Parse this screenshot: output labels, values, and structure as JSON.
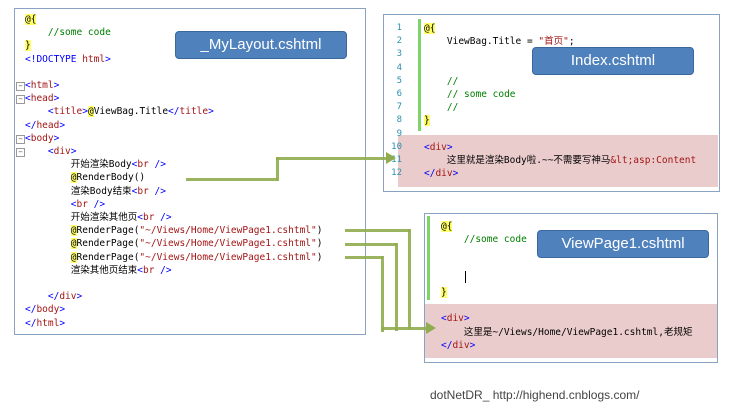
{
  "layout_panel": {
    "badge": "_MyLayout.cshtml",
    "lines": [
      {
        "parts": [
          {
            "t": "@{",
            "c": "razor"
          }
        ]
      },
      {
        "parts": [
          {
            "t": "    //some code",
            "c": "green"
          }
        ]
      },
      {
        "parts": [
          {
            "t": "}",
            "c": "razor"
          }
        ]
      },
      {
        "parts": [
          {
            "t": "<!DOCTYPE ",
            "c": "blue"
          },
          {
            "t": "html",
            "c": "tag"
          },
          {
            "t": ">",
            "c": "blue"
          }
        ]
      },
      {
        "parts": [
          {
            "t": "",
            "c": "black"
          }
        ]
      },
      {
        "parts": [
          {
            "t": "<",
            "c": "blue"
          },
          {
            "t": "html",
            "c": "tag"
          },
          {
            "t": ">",
            "c": "blue"
          }
        ]
      },
      {
        "parts": [
          {
            "t": "<",
            "c": "blue"
          },
          {
            "t": "head",
            "c": "tag"
          },
          {
            "t": ">",
            "c": "blue"
          }
        ]
      },
      {
        "parts": [
          {
            "t": "    <",
            "c": "blue"
          },
          {
            "t": "title",
            "c": "tag"
          },
          {
            "t": ">",
            "c": "blue"
          },
          {
            "t": "@",
            "c": "razor"
          },
          {
            "t": "ViewBag.Title",
            "c": "black"
          },
          {
            "t": "</",
            "c": "blue"
          },
          {
            "t": "title",
            "c": "tag"
          },
          {
            "t": ">",
            "c": "blue"
          }
        ]
      },
      {
        "parts": [
          {
            "t": "</",
            "c": "blue"
          },
          {
            "t": "head",
            "c": "tag"
          },
          {
            "t": ">",
            "c": "blue"
          }
        ]
      },
      {
        "parts": [
          {
            "t": "<",
            "c": "blue"
          },
          {
            "t": "body",
            "c": "tag"
          },
          {
            "t": ">",
            "c": "blue"
          }
        ]
      },
      {
        "parts": [
          {
            "t": "    <",
            "c": "blue"
          },
          {
            "t": "div",
            "c": "tag"
          },
          {
            "t": ">",
            "c": "blue"
          }
        ]
      },
      {
        "parts": [
          {
            "t": "        开始渲染Body",
            "c": "black"
          },
          {
            "t": "<",
            "c": "blue"
          },
          {
            "t": "br",
            "c": "tag"
          },
          {
            "t": " />",
            "c": "blue"
          }
        ]
      },
      {
        "parts": [
          {
            "t": "        ",
            "c": "black"
          },
          {
            "t": "@",
            "c": "razor"
          },
          {
            "t": "RenderBody()",
            "c": "black"
          }
        ]
      },
      {
        "parts": [
          {
            "t": "        渲染Body结束",
            "c": "black"
          },
          {
            "t": "<",
            "c": "blue"
          },
          {
            "t": "br",
            "c": "tag"
          },
          {
            "t": " />",
            "c": "blue"
          }
        ]
      },
      {
        "parts": [
          {
            "t": "        <",
            "c": "blue"
          },
          {
            "t": "br",
            "c": "tag"
          },
          {
            "t": " />",
            "c": "blue"
          }
        ]
      },
      {
        "parts": [
          {
            "t": "        开始渲染其他页",
            "c": "black"
          },
          {
            "t": "<",
            "c": "blue"
          },
          {
            "t": "br",
            "c": "tag"
          },
          {
            "t": " />",
            "c": "blue"
          }
        ]
      },
      {
        "parts": [
          {
            "t": "        ",
            "c": "black"
          },
          {
            "t": "@",
            "c": "razor"
          },
          {
            "t": "RenderPage(",
            "c": "black"
          },
          {
            "t": "\"~/Views/Home/ViewPage1.cshtml\"",
            "c": "tag"
          },
          {
            "t": ")",
            "c": "black"
          }
        ]
      },
      {
        "parts": [
          {
            "t": "        ",
            "c": "black"
          },
          {
            "t": "@",
            "c": "razor"
          },
          {
            "t": "RenderPage(",
            "c": "black"
          },
          {
            "t": "\"~/Views/Home/ViewPage1.cshtml\"",
            "c": "tag"
          },
          {
            "t": ")",
            "c": "black"
          }
        ]
      },
      {
        "parts": [
          {
            "t": "        ",
            "c": "black"
          },
          {
            "t": "@",
            "c": "razor"
          },
          {
            "t": "RenderPage(",
            "c": "black"
          },
          {
            "t": "\"~/Views/Home/ViewPage1.cshtml\"",
            "c": "tag"
          },
          {
            "t": ")",
            "c": "black"
          }
        ]
      },
      {
        "parts": [
          {
            "t": "        渲染其他页结束",
            "c": "black"
          },
          {
            "t": "<",
            "c": "blue"
          },
          {
            "t": "br",
            "c": "tag"
          },
          {
            "t": " />",
            "c": "blue"
          }
        ]
      },
      {
        "parts": [
          {
            "t": "",
            "c": "black"
          }
        ]
      },
      {
        "parts": [
          {
            "t": "    </",
            "c": "blue"
          },
          {
            "t": "div",
            "c": "tag"
          },
          {
            "t": ">",
            "c": "blue"
          }
        ]
      },
      {
        "parts": [
          {
            "t": "</",
            "c": "blue"
          },
          {
            "t": "body",
            "c": "tag"
          },
          {
            "t": ">",
            "c": "blue"
          }
        ]
      },
      {
        "parts": [
          {
            "t": "</",
            "c": "blue"
          },
          {
            "t": "html",
            "c": "tag"
          },
          {
            "t": ">",
            "c": "blue"
          }
        ]
      }
    ]
  },
  "index_panel": {
    "badge": "Index.cshtml",
    "line_numbers": [
      "1",
      "2",
      "3",
      "4",
      "5",
      "6",
      "7",
      "8",
      "9",
      "10",
      "11",
      "12"
    ],
    "lines": [
      {
        "parts": [
          {
            "t": "@{",
            "c": "razor"
          }
        ]
      },
      {
        "parts": [
          {
            "t": "    ViewBag.Title = ",
            "c": "black"
          },
          {
            "t": "\"首页\"",
            "c": "tag"
          },
          {
            "t": ";",
            "c": "black"
          }
        ]
      },
      {
        "parts": [
          {
            "t": "",
            "c": "black"
          }
        ]
      },
      {
        "parts": [
          {
            "t": "",
            "c": "black"
          }
        ]
      },
      {
        "parts": [
          {
            "t": "    //",
            "c": "green"
          }
        ]
      },
      {
        "parts": [
          {
            "t": "    // some code",
            "c": "green"
          }
        ]
      },
      {
        "parts": [
          {
            "t": "    //",
            "c": "green"
          }
        ]
      },
      {
        "parts": [
          {
            "t": "}",
            "c": "razor"
          }
        ]
      },
      {
        "parts": [
          {
            "t": "",
            "c": "black"
          }
        ]
      },
      {
        "parts": [
          {
            "t": "<",
            "c": "blue"
          },
          {
            "t": "div",
            "c": "tag"
          },
          {
            "t": ">",
            "c": "blue"
          }
        ]
      },
      {
        "parts": [
          {
            "t": "    这里就是渲染Body啦.~~不需要写神马",
            "c": "black"
          },
          {
            "t": "&lt;asp:Content",
            "c": "tag"
          }
        ]
      },
      {
        "parts": [
          {
            "t": "</",
            "c": "blue"
          },
          {
            "t": "div",
            "c": "tag"
          },
          {
            "t": ">",
            "c": "blue"
          }
        ]
      }
    ]
  },
  "viewpage_panel": {
    "badge": "ViewPage1.cshtml",
    "lines": [
      {
        "parts": [
          {
            "t": "@{",
            "c": "razor"
          }
        ]
      },
      {
        "parts": [
          {
            "t": "    //some code",
            "c": "green"
          }
        ]
      },
      {
        "parts": [
          {
            "t": "",
            "c": "black"
          }
        ]
      },
      {
        "parts": [
          {
            "t": "",
            "c": "black"
          }
        ]
      },
      {
        "parts": [
          {
            "t": "",
            "c": "black"
          }
        ]
      },
      {
        "parts": [
          {
            "t": "}",
            "c": "razor"
          }
        ]
      },
      {
        "parts": [
          {
            "t": "",
            "c": "black"
          }
        ]
      },
      {
        "parts": [
          {
            "t": "<",
            "c": "blue"
          },
          {
            "t": "div",
            "c": "tag"
          },
          {
            "t": ">",
            "c": "blue"
          }
        ]
      },
      {
        "parts": [
          {
            "t": "    这里是~/Views/Home/ViewPage1.cshtml,老规矩",
            "c": "black"
          }
        ]
      },
      {
        "parts": [
          {
            "t": "</",
            "c": "blue"
          },
          {
            "t": "div",
            "c": "tag"
          },
          {
            "t": ">",
            "c": "blue"
          }
        ]
      }
    ]
  },
  "watermark": "dotNetDR_  http://highend.cnblogs.com/",
  "colors": {
    "accent": "#4f81bd",
    "arrow": "#8fac4e",
    "highlight": "#e8c3c3"
  }
}
